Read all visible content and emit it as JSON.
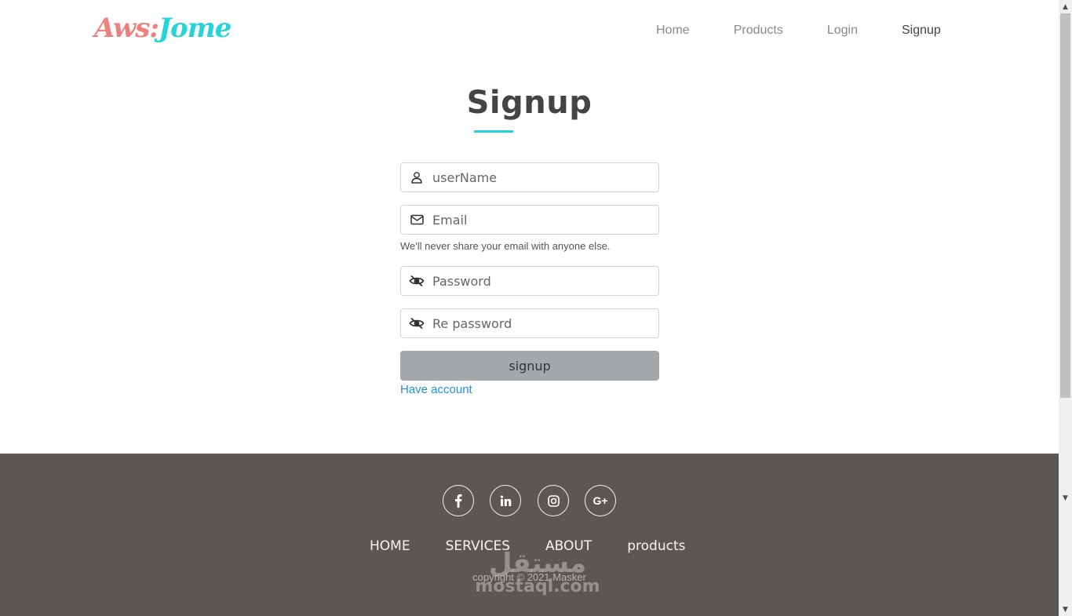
{
  "navbar": {
    "logo_part1": "Aws:",
    "logo_part2": "Jome",
    "links": [
      {
        "label": "Home"
      },
      {
        "label": "Products"
      },
      {
        "label": "Login"
      },
      {
        "label": "Signup",
        "active": true
      }
    ]
  },
  "form": {
    "title": "Signup",
    "username_placeholder": "userName",
    "email_placeholder": "Email",
    "email_help": "We'll never share your email with anyone else.",
    "password_placeholder": "Password",
    "repassword_placeholder": "Re password",
    "submit_label": "signup",
    "have_account_label": "Have account"
  },
  "icons": {
    "username": "user-icon",
    "email": "envelope-icon",
    "password": "eye-slash-icon",
    "repassword": "eye-slash-icon"
  },
  "footer": {
    "social": [
      "facebook-icon",
      "linkedin-icon",
      "instagram-icon",
      "google-plus-icon"
    ],
    "google_plus_label": "G+",
    "links": [
      {
        "label": "HOME"
      },
      {
        "label": "SERVICES"
      },
      {
        "label": "ABOUT"
      },
      {
        "label": "products"
      }
    ],
    "copyright": "copyright © 2021 Masker",
    "watermark_ar": "مستقل",
    "watermark_en": "mostaql.com"
  },
  "colors": {
    "accent": "#25d3dc",
    "logo_pink": "#ee7f7f",
    "button": "#a4a8ab",
    "link": "#1c95d8",
    "footer_bg": "#5c5655"
  }
}
